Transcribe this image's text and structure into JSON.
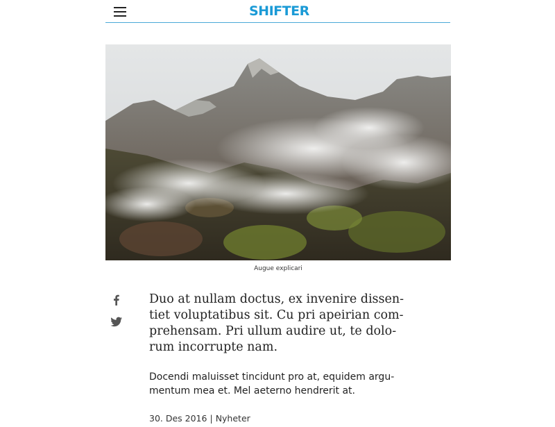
{
  "header": {
    "logo_text": "SHIFTER",
    "menu_icon": "hamburger-menu-icon",
    "accent_color": "#1a9ad6",
    "divider_color": "#4aa8d8"
  },
  "hero": {
    "caption": "Augue explicari"
  },
  "share": {
    "icons": [
      "facebook-icon",
      "twitter-icon"
    ]
  },
  "article": {
    "lead": "Duo at nullam doctus, ex invenire dissen-tiet voluptatibus sit. Cu pri apeirian com-prehensam. Pri ullum audire ut, te dolo-rum incorrupte nam.",
    "body": "Docendi maluisset tincidunt pro at, equidem argu-mentum mea et. Mel aeterno hendrerit at.",
    "date": "30. Des 2016",
    "category": "Nyheter"
  }
}
